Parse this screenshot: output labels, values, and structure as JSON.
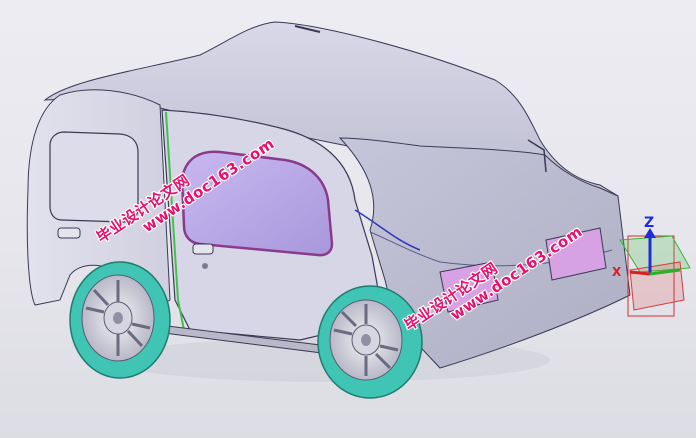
{
  "watermarks": [
    {
      "line1": "毕业设计论文网",
      "line2": "www.doc163.com"
    },
    {
      "line1": "毕业设计论文网",
      "line2": "www.doc163.com"
    }
  ],
  "triad": {
    "z_label": "Z",
    "x_label": "X"
  },
  "colors": {
    "body": "#c4c4d8",
    "window_tint": "#b9a7e4",
    "tire": "#40c4b4",
    "watermark": "#e8106c",
    "edge": "#3a3a55",
    "accent_green": "#44c04c",
    "accent_magenta": "#b040b0"
  },
  "icons": [
    "coordinate-triad-icon"
  ]
}
